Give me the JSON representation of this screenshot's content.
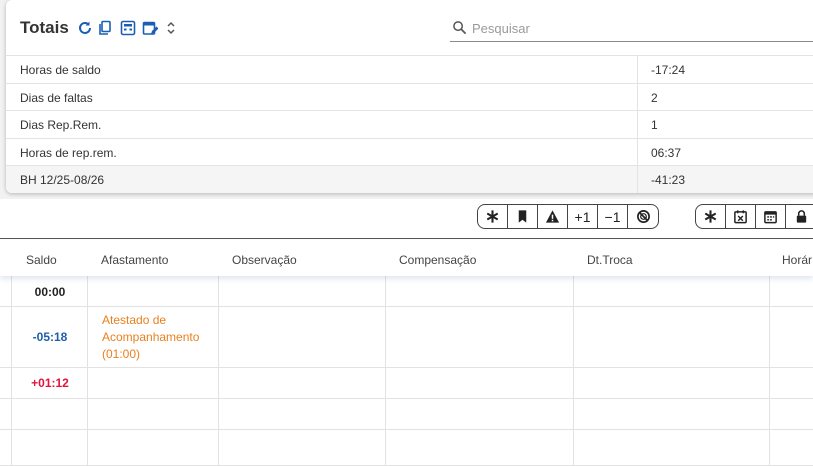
{
  "totais": {
    "title": "Totais",
    "icons": [
      "refresh-icon",
      "copy-icon",
      "calculator-icon",
      "calendar-edit-icon",
      "sort-icon"
    ],
    "search": {
      "placeholder": "Pesquisar",
      "value": ""
    },
    "rows": [
      {
        "label": "Horas de saldo",
        "value": "-17:24"
      },
      {
        "label": "Dias de faltas",
        "value": "2"
      },
      {
        "label": "Dias Rep.Rem.",
        "value": "1"
      },
      {
        "label": "Horas de rep.rem.",
        "value": "06:37"
      },
      {
        "label": "BH 12/25-08/26",
        "value": "-41:23"
      }
    ]
  },
  "toolbar": {
    "group1": [
      {
        "icon": "asterisk-icon"
      },
      {
        "icon": "bookmark-icon"
      },
      {
        "icon": "warning-icon"
      },
      {
        "label": "+1"
      },
      {
        "label": "−1"
      },
      {
        "icon": "no-alarm-icon"
      }
    ],
    "group2": [
      {
        "icon": "asterisk-icon"
      },
      {
        "icon": "calendar-x-icon"
      },
      {
        "icon": "calendar-icon"
      },
      {
        "icon": "lock-icon"
      }
    ]
  },
  "grid": {
    "columns": [
      "Saldo",
      "Afastamento",
      "Observação",
      "Compensação",
      "Dt.Troca",
      "Horár"
    ],
    "rows": [
      {
        "saldo": "00:00",
        "saldo_color": "#222222",
        "afastamento": ""
      },
      {
        "saldo": "-05:18",
        "saldo_color": "#1e5fa8",
        "afastamento": "Atestado de Acompanhamento (01:00)"
      },
      {
        "saldo": "+01:12",
        "saldo_color": "#e0143c",
        "afastamento": ""
      },
      {
        "saldo": "",
        "saldo_color": "#222222",
        "afastamento": ""
      },
      {
        "saldo": "",
        "saldo_color": "#222222",
        "afastamento": ""
      }
    ]
  },
  "colors": {
    "accent": "#1a5fb4",
    "negative": "#1e5fa8",
    "positive": "#e0143c",
    "absence": "#e8801e"
  }
}
